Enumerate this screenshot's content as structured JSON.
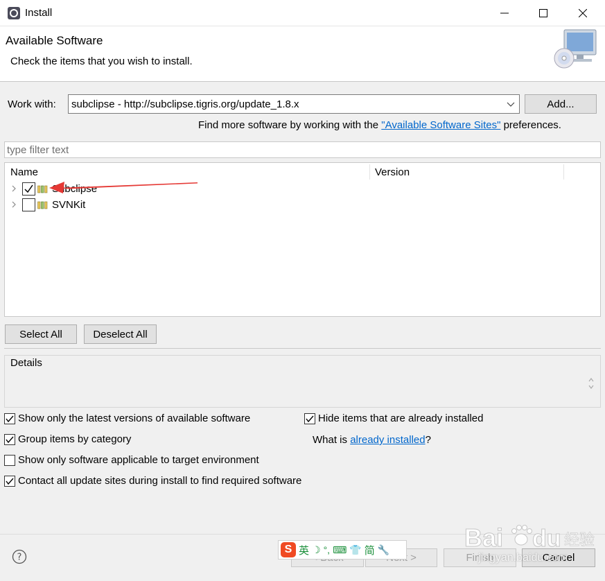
{
  "window": {
    "title": "Install",
    "minimize_icon": "minimize-icon",
    "maximize_icon": "maximize-icon",
    "close_icon": "close-icon"
  },
  "header": {
    "title": "Available Software",
    "subtitle": "Check the items that you wish to install."
  },
  "work_with": {
    "label": "Work with:",
    "value": "subclipse - http://subclipse.tigris.org/update_1.8.x",
    "add_button": "Add..."
  },
  "find_more": {
    "prefix": "Find more software by working with the ",
    "link": "\"Available Software Sites\"",
    "suffix": " preferences."
  },
  "filter": {
    "placeholder": "type filter text"
  },
  "tree": {
    "columns": [
      "Name",
      "Version"
    ],
    "items": [
      {
        "label": "Subclipse",
        "checked": true
      },
      {
        "label": "SVNKit",
        "checked": false
      }
    ]
  },
  "buttons": {
    "select_all": "Select All",
    "deselect_all": "Deselect All"
  },
  "details": {
    "label": "Details"
  },
  "options": {
    "latest_versions": {
      "label": "Show only the latest versions of available software",
      "checked": true
    },
    "hide_installed": {
      "label": "Hide items that are already installed",
      "checked": true
    },
    "group_category": {
      "label": "Group items by category",
      "checked": true
    },
    "what_is_prefix": "What is ",
    "what_is_link": "already installed",
    "what_is_suffix": "?",
    "target_env": {
      "label": "Show only software applicable to target environment",
      "checked": false
    },
    "contact_sites": {
      "label": "Contact all update sites during install to find required software",
      "checked": true
    }
  },
  "nav": {
    "back": "< Back",
    "next": "Next >",
    "finish": "Finish",
    "cancel": "Cancel"
  },
  "ime": {
    "logo": "S",
    "items": [
      "英",
      "☽",
      "°,",
      "⌨",
      "👕",
      "简",
      "🔧"
    ]
  },
  "watermark": {
    "brand": "Bai",
    "brand2": "经验",
    "url": "jingyan.baidu.com"
  },
  "colors": {
    "link": "#0066cc",
    "annotation_arrow": "#e53935",
    "ime_logo": "#f04a23"
  }
}
